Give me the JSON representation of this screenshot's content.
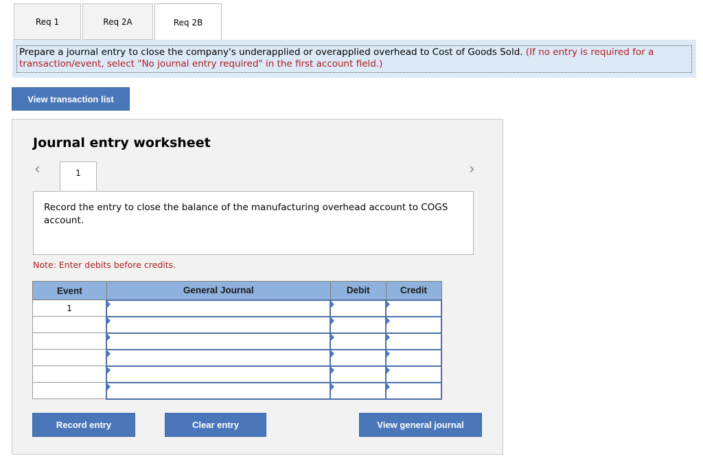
{
  "tabs": [
    {
      "label": "Req 1"
    },
    {
      "label": "Req 2A"
    },
    {
      "label": "Req 2B",
      "active": true
    }
  ],
  "instruction": {
    "main": "Prepare a journal entry to close the company's underapplied or overapplied overhead to Cost of Goods Sold.",
    "hint": "(If no entry is required for a transaction/event, select \"No journal entry required\" in the first account field.)"
  },
  "buttons": {
    "view_transaction_list": "View transaction list",
    "record_entry": "Record entry",
    "clear_entry": "Clear entry",
    "view_general_journal": "View general journal"
  },
  "worksheet": {
    "title": "Journal entry worksheet",
    "entry_number": "1",
    "description": "Record the entry to close the balance of the manufacturing overhead account to COGS account.",
    "note": "Note: Enter debits before credits."
  },
  "table": {
    "headers": {
      "event": "Event",
      "journal": "General Journal",
      "debit": "Debit",
      "credit": "Credit"
    },
    "rows": [
      {
        "event": "1",
        "account": "",
        "debit": "",
        "credit": ""
      },
      {
        "event": "",
        "account": "",
        "debit": "",
        "credit": ""
      },
      {
        "event": "",
        "account": "",
        "debit": "",
        "credit": ""
      },
      {
        "event": "",
        "account": "",
        "debit": "",
        "credit": ""
      },
      {
        "event": "",
        "account": "",
        "debit": "",
        "credit": ""
      },
      {
        "event": "",
        "account": "",
        "debit": "",
        "credit": ""
      }
    ]
  },
  "icons": {
    "prev": "chevron-left-icon",
    "next": "chevron-right-icon"
  },
  "colors": {
    "button": "#4a77ba",
    "header": "#8eb2dd",
    "instruction_bg": "#dce9f7",
    "hint_red": "#b11b1b"
  }
}
